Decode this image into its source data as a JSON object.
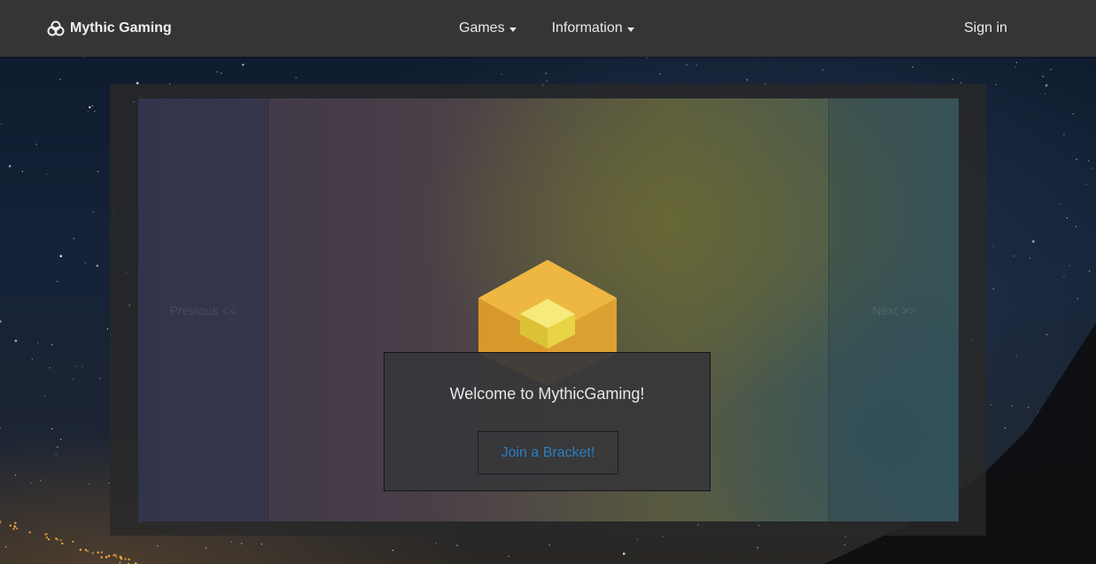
{
  "navbar": {
    "brand_icon": "triquetra-logo-icon",
    "brand_label": "Mythic Gaming",
    "menu": [
      {
        "label": "Games",
        "icon": "caret-down-icon"
      },
      {
        "label": "Information",
        "icon": "caret-down-icon"
      }
    ],
    "signin_label": "Sign in"
  },
  "carousel": {
    "prev_label": "Previous <<",
    "next_label": "Next >>",
    "slide_image": "yellow-cube-logo",
    "caption": {
      "title": "Welcome to MythicGaming!",
      "button_label": "Join a Bracket!"
    }
  },
  "colors": {
    "navbar_bg": "#353535",
    "button_text": "#2b7fc2",
    "cube_outer": "#e7a731",
    "cube_inner": "#f1e14e"
  }
}
